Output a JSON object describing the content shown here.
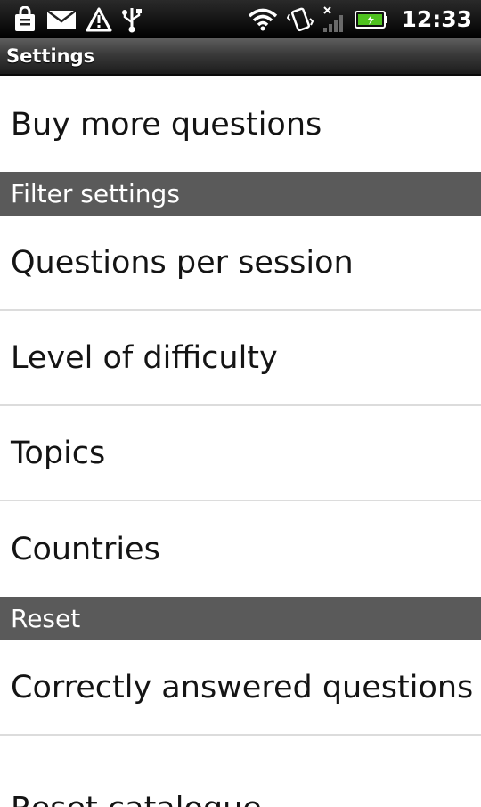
{
  "status_bar": {
    "time": "12:33",
    "icons": [
      "shopping-bag-icon",
      "mail-icon",
      "warning-icon",
      "usb-icon",
      "wifi-icon",
      "vibrate-icon",
      "signal-icon",
      "battery-icon"
    ]
  },
  "title_bar": {
    "title": "Settings"
  },
  "settings": {
    "buy_more": "Buy more questions",
    "filter_header": "Filter settings",
    "filter_items": [
      "Questions per session",
      "Level of difficulty",
      "Topics",
      "Countries"
    ],
    "reset_header": "Reset",
    "reset_items": [
      "Correctly answered questions",
      "Reset catalogue"
    ]
  }
}
